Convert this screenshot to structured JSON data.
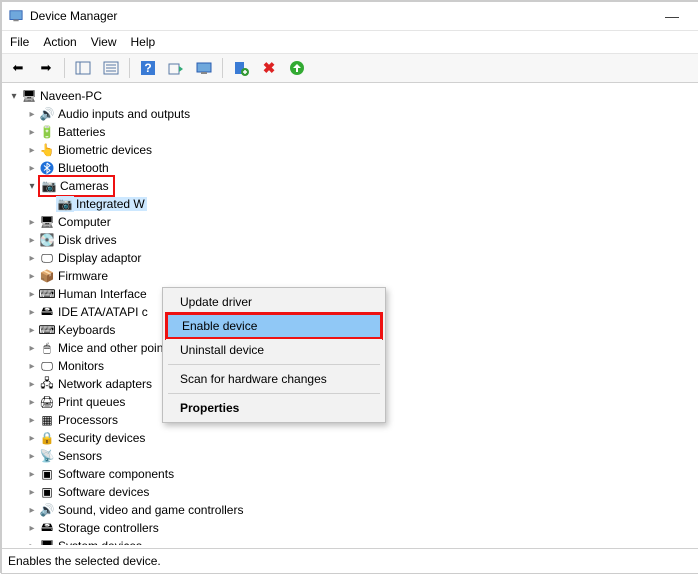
{
  "window": {
    "title": "Device Manager",
    "minimize": "—"
  },
  "menu": {
    "file": "File",
    "action": "Action",
    "view": "View",
    "help": "Help"
  },
  "toolbar": {
    "back": "←",
    "forward": "→",
    "show_hide": "▭",
    "properties": "☰",
    "help": "?",
    "update": "▶",
    "scan": "🖥",
    "add": "＋",
    "remove": "✖",
    "refresh": "⟳"
  },
  "tree": {
    "root": "Naveen-PC",
    "nodes": [
      {
        "label": "Audio inputs and outputs",
        "icon": "🔊"
      },
      {
        "label": "Batteries",
        "icon": "🔋"
      },
      {
        "label": "Biometric devices",
        "icon": "👆"
      },
      {
        "label": "Bluetooth",
        "icon": "ᚼ"
      },
      {
        "label": "Cameras",
        "icon": "📷",
        "expanded": true,
        "red": true,
        "children": [
          {
            "label": "Integrated W",
            "icon": "📷",
            "selected": true
          }
        ]
      },
      {
        "label": "Computer",
        "icon": "🖥"
      },
      {
        "label": "Disk drives",
        "icon": "💽"
      },
      {
        "label": "Display adaptor",
        "icon": "🖵"
      },
      {
        "label": "Firmware",
        "icon": "📦"
      },
      {
        "label": "Human Interface",
        "icon": "⌨"
      },
      {
        "label": "IDE ATA/ATAPI c",
        "icon": "🖴"
      },
      {
        "label": "Keyboards",
        "icon": "⌨"
      },
      {
        "label": "Mice and other pointing devices",
        "icon": "🖱"
      },
      {
        "label": "Monitors",
        "icon": "🖵"
      },
      {
        "label": "Network adapters",
        "icon": "🖧"
      },
      {
        "label": "Print queues",
        "icon": "🖨"
      },
      {
        "label": "Processors",
        "icon": "▦"
      },
      {
        "label": "Security devices",
        "icon": "🔒"
      },
      {
        "label": "Sensors",
        "icon": "📡"
      },
      {
        "label": "Software components",
        "icon": "▣"
      },
      {
        "label": "Software devices",
        "icon": "▣"
      },
      {
        "label": "Sound, video and game controllers",
        "icon": "🔊"
      },
      {
        "label": "Storage controllers",
        "icon": "🖴"
      },
      {
        "label": "System devices",
        "icon": "🖥"
      }
    ]
  },
  "context_menu": {
    "update": "Update driver",
    "enable": "Enable device",
    "uninstall": "Uninstall device",
    "scan": "Scan for hardware changes",
    "properties": "Properties"
  },
  "statusbar": {
    "text": "Enables the selected device."
  }
}
